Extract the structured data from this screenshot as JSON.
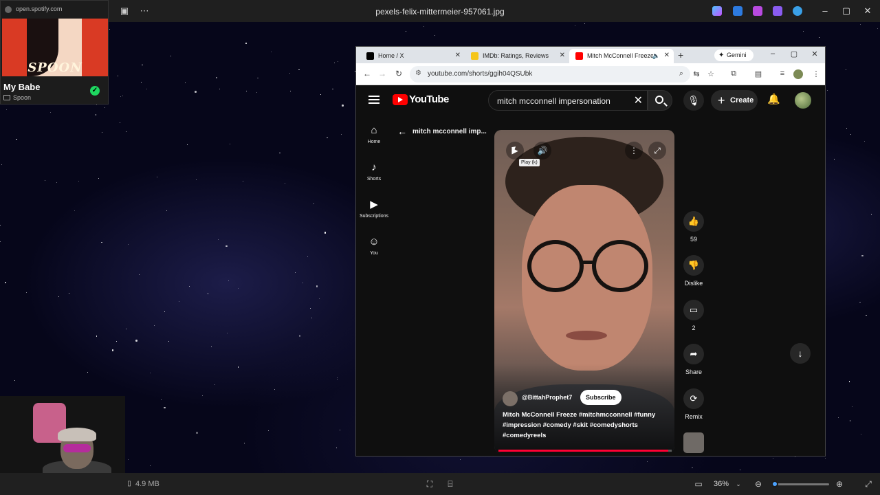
{
  "viewer": {
    "title": "pexels-felix-mittermeier-957061.jpg",
    "file_size": "4.9 MB",
    "zoom": "36%",
    "zoom_level": 0.05
  },
  "spotify": {
    "url": "open.spotify.com",
    "album_logo": "SPOON",
    "track": "My Babe",
    "artist": "Spoon"
  },
  "browser": {
    "tabs": [
      {
        "label": "Home / X",
        "favicon_color": "#000000"
      },
      {
        "label": "IMDb: Ratings, Reviews, and W",
        "favicon_color": "#f5c518"
      },
      {
        "label": "Mitch McConnell Freeze #",
        "favicon_color": "#ff0000"
      }
    ],
    "gemini_label": "Gemini",
    "url": "youtube.com/shorts/ggih04QSUbk"
  },
  "youtube": {
    "logo_text": "YouTube",
    "search_value": "mitch mcconnell impersonation",
    "create_label": "Create",
    "sidebar": [
      {
        "label": "Home",
        "icon": "home-icon"
      },
      {
        "label": "Shorts",
        "icon": "shorts-icon"
      },
      {
        "label": "Subscriptions",
        "icon": "subscriptions-icon"
      },
      {
        "label": "You",
        "icon": "you-icon"
      }
    ],
    "back_query": "mitch mcconnell imp...",
    "short": {
      "tooltip": "Play (k)",
      "channel": "@BittahProphet7",
      "subscribe": "Subscribe",
      "caption": "Mitch McConnell Freeze #mitchmcconnell #funny #impression #comedy #skit #comedyshorts #comedyreels",
      "progress": 0.98
    },
    "actions": {
      "likes": "59",
      "dislike": "Dislike",
      "comments": "2",
      "share": "Share",
      "remix": "Remix"
    }
  }
}
